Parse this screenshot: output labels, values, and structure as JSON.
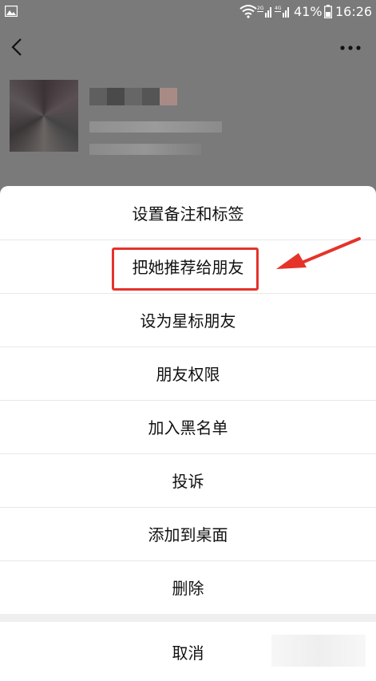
{
  "status_bar": {
    "battery_percent": "41%",
    "time": "16:26",
    "network_labels": [
      "2G",
      "4G"
    ]
  },
  "topbar": {
    "back_icon": "chevron-left-icon",
    "more_icon": "more-dots-icon"
  },
  "menu": {
    "items": [
      "设置备注和标签",
      "把她推荐给朋友",
      "设为星标朋友",
      "朋友权限",
      "加入黑名单",
      "投诉",
      "添加到桌面",
      "删除"
    ],
    "cancel": "取消",
    "highlighted_index": 1
  },
  "colors": {
    "annotation_red": "#e5332a",
    "overlay": "#7a7a7a",
    "sheet": "#ffffff"
  }
}
